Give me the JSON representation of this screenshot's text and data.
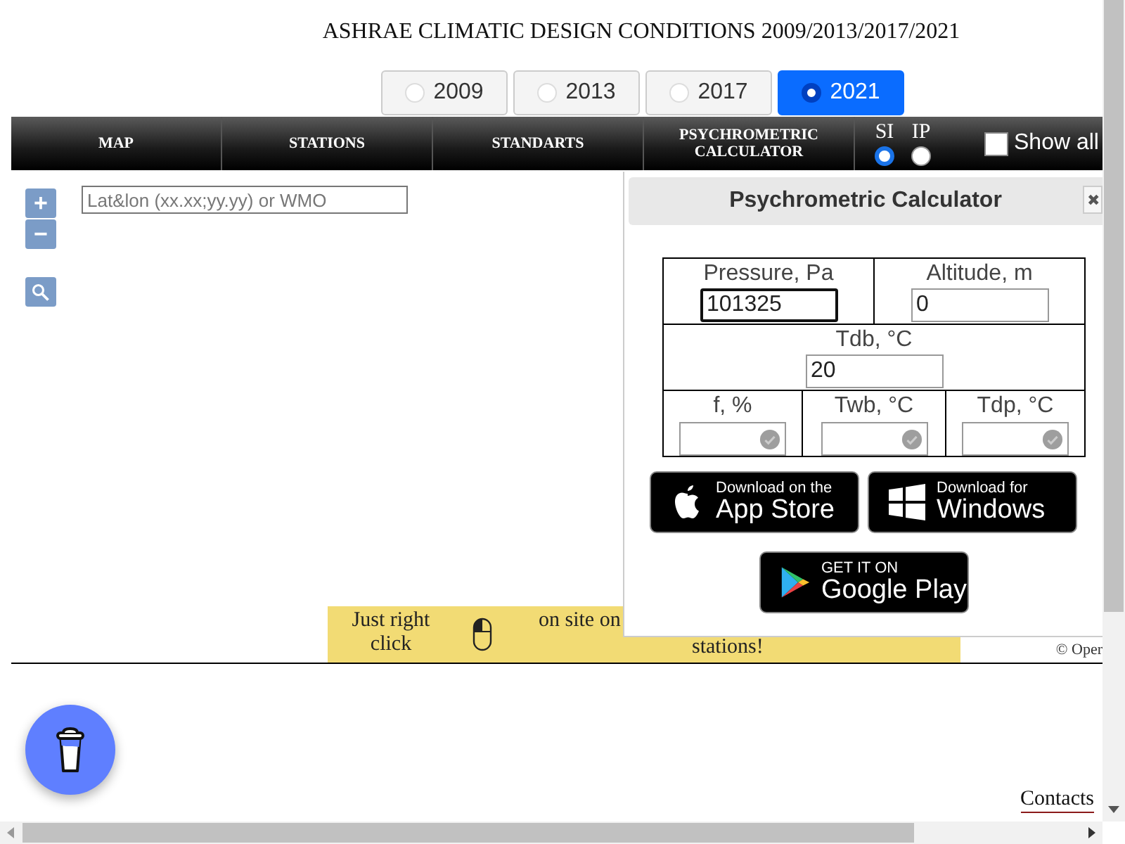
{
  "page_title": "ASHRAE CLIMATIC DESIGN CONDITIONS 2009/2013/2017/2021",
  "year_tabs": [
    {
      "label": "2009",
      "selected": false
    },
    {
      "label": "2013",
      "selected": false
    },
    {
      "label": "2017",
      "selected": false
    },
    {
      "label": "2021",
      "selected": true
    }
  ],
  "nav": {
    "items": [
      {
        "label": "MAP"
      },
      {
        "label": "STATIONS"
      },
      {
        "label": "STANDARTS"
      },
      {
        "label": "PSYCHROMETRIC CALCULATOR"
      }
    ],
    "units": [
      {
        "label": "SI",
        "selected": true
      },
      {
        "label": "IP",
        "selected": false
      }
    ],
    "show_all": {
      "label": "Show all",
      "checked": false
    }
  },
  "map": {
    "zoom_in": "+",
    "zoom_out": "−",
    "search": {
      "placeholder": "Lat&lon (xx.xx;yy.yy) or WMO"
    },
    "banner": {
      "text_1": "Just right click",
      "text_2": "on site on",
      "text_3": "stations!"
    },
    "attribution": "© Oper"
  },
  "calculator": {
    "title": "Psychrometric Calculator",
    "close": "✖",
    "inputs": [
      {
        "label": "Pressure, Pa",
        "value": "101325",
        "focused": true
      },
      {
        "label": "Altitude, m",
        "value": "0",
        "focused": false
      }
    ],
    "dry_bulb": {
      "label": "Tdb, °C",
      "value": "20",
      "focused": false
    },
    "outputs": [
      {
        "label": "f, %",
        "focused": false,
        "kind": "output"
      },
      {
        "label": "Twb, °C",
        "focused": false,
        "kind": "output"
      },
      {
        "label": "Tdp, °C",
        "focused": false,
        "kind": "output"
      }
    ],
    "badges": [
      {
        "kind": "apple",
        "small": "Download on the",
        "big": "App Store"
      },
      {
        "kind": "windows",
        "small": "Download for",
        "big": "Windows"
      },
      {
        "kind": "google-play",
        "small": "GET IT ON",
        "big": "Google Play"
      }
    ]
  },
  "footer": {
    "contacts": "Contacts"
  }
}
